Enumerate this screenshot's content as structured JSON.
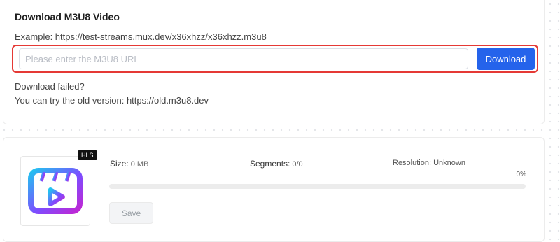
{
  "download_section": {
    "title": "Download M3U8 Video",
    "example": "Example: https://test-streams.mux.dev/x36xhzz/x36xhzz.m3u8",
    "input_value": "",
    "input_placeholder": "Please enter the M3U8 URL",
    "download_label": "Download",
    "failed_text": "Download failed?",
    "old_version_text": "You can try the old version: https://old.m3u8.dev"
  },
  "task": {
    "badge": "HLS",
    "icon": "video-player-icon",
    "size_label": "Size:",
    "size_value": "0 MB",
    "segments_label": "Segments:",
    "segments_value": "0/0",
    "resolution_text": "Resolution: Unknown",
    "progress_text": "0%",
    "progress_value": 0,
    "save_label": "Save"
  },
  "colors": {
    "accent": "#2563eb",
    "highlight_border": "#e53935",
    "icon_gradient": [
      "#22c3f0",
      "#7c4dff",
      "#c026d3"
    ]
  }
}
